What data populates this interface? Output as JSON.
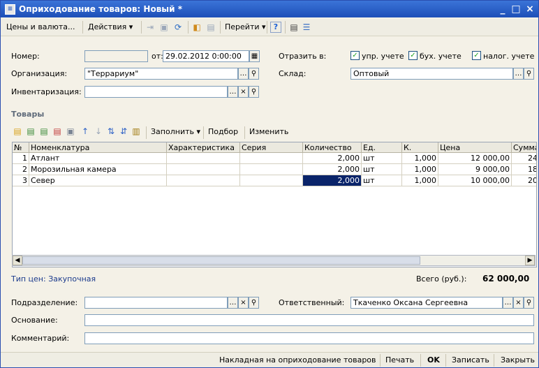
{
  "window": {
    "title": "Оприходование товаров: Новый *",
    "minimize": "_",
    "maximize": "□",
    "close": "×"
  },
  "toolbar": {
    "prices": "Цены и валюта...",
    "actions": "Действия ▾",
    "goto": "Перейти ▾",
    "help": "?"
  },
  "header": {
    "number_label": "Номер:",
    "number_value": "",
    "from_label": "от:",
    "date_value": "29.02.2012  0:00:00",
    "reflect_label": "Отразить в:",
    "checks": [
      "упр. учете",
      "бух. учете",
      "налог. учете"
    ],
    "org_label": "Организация:",
    "org_value": "\"Террариум\"",
    "warehouse_label": "Склад:",
    "warehouse_value": "Оптовый",
    "inventory_label": "Инвентаризация:",
    "inventory_value": ""
  },
  "goods": {
    "section_title": "Товары",
    "fill_label": "Заполнить ▾",
    "select_label": "Подбор",
    "change_label": "Изменить",
    "columns": [
      "№",
      "Номенклатура",
      "Характеристика",
      "Серия",
      "Количество",
      "Ед.",
      "К.",
      "Цена",
      "Сумма"
    ],
    "rows": [
      {
        "n": "1",
        "name": "Атлант",
        "char": "",
        "series": "",
        "qty": "2,000",
        "unit": "шт",
        "k": "1,000",
        "price": "12 000,00",
        "sum": "24"
      },
      {
        "n": "2",
        "name": "Морозильная камера",
        "char": "",
        "series": "",
        "qty": "2,000",
        "unit": "шт",
        "k": "1,000",
        "price": "9 000,00",
        "sum": "18"
      },
      {
        "n": "3",
        "name": "Север",
        "char": "",
        "series": "",
        "qty": "2,000",
        "unit": "шт",
        "k": "1,000",
        "price": "10 000,00",
        "sum": "20"
      }
    ]
  },
  "summary": {
    "price_type": "Тип цен: Закупочная",
    "total_label": "Всего (руб.):",
    "total_value": "62 000,00"
  },
  "footer": {
    "dept_label": "Подразделение:",
    "dept_value": "",
    "resp_label": "Ответственный:",
    "resp_value": "Ткаченко Оксана Сергеевна",
    "basis_label": "Основание:",
    "basis_value": "",
    "comment_label": "Комментарий:",
    "comment_value": ""
  },
  "bottom": {
    "invoice": "Накладная на оприходование товаров",
    "print": "Печать",
    "ok": "OK",
    "save": "Записать",
    "close": "Закрыть"
  },
  "colors": {
    "title_bar": "#1d4fb8",
    "selected_cell": "#0a246a",
    "section_title": "#5f6b7a",
    "price_type": "#1a3a8c"
  }
}
